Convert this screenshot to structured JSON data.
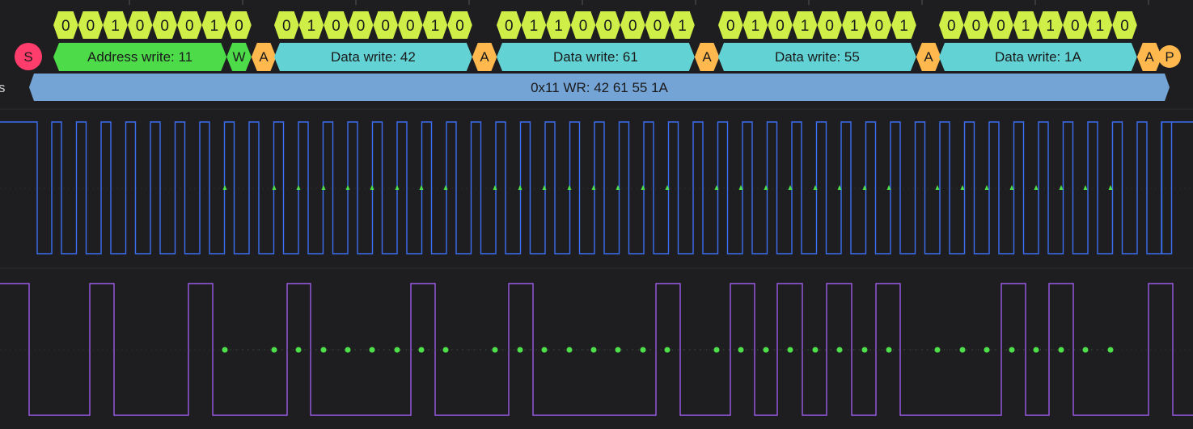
{
  "colors": {
    "background": "#1e1e20",
    "grid": "#2c2c2f",
    "bit": "#cfee48",
    "address": "#4ddb4a",
    "data": "#62d2d4",
    "ack": "#ffb84d",
    "start": "#ff3d6c",
    "stop": "#ffb84d",
    "transaction": "#74a4d6",
    "scl": "#3b6ff2",
    "sda": "#9b5ce8",
    "sample": "#4de04a"
  },
  "side_label": "s",
  "start_marker": "S",
  "stop_marker": "P",
  "frames": [
    {
      "kind": "address",
      "bits": [
        "0",
        "0",
        "1",
        "0",
        "0",
        "0",
        "1"
      ],
      "label": "Address write: 11",
      "rw_bit": "0",
      "rw_label": "W",
      "ack": "A"
    },
    {
      "kind": "data",
      "bits": [
        "0",
        "1",
        "0",
        "0",
        "0",
        "0",
        "1",
        "0"
      ],
      "label": "Data write: 42",
      "ack": "A"
    },
    {
      "kind": "data",
      "bits": [
        "0",
        "1",
        "1",
        "0",
        "0",
        "0",
        "0",
        "1"
      ],
      "label": "Data write: 61",
      "ack": "A"
    },
    {
      "kind": "data",
      "bits": [
        "0",
        "1",
        "0",
        "1",
        "0",
        "1",
        "0",
        "1"
      ],
      "label": "Data write: 55",
      "ack": "A"
    },
    {
      "kind": "data",
      "bits": [
        "0",
        "0",
        "0",
        "1",
        "1",
        "0",
        "1",
        "0"
      ],
      "label": "Data write: 1A",
      "ack": "A"
    }
  ],
  "transaction_label": "0x11 WR: 42 61 55 1A"
}
